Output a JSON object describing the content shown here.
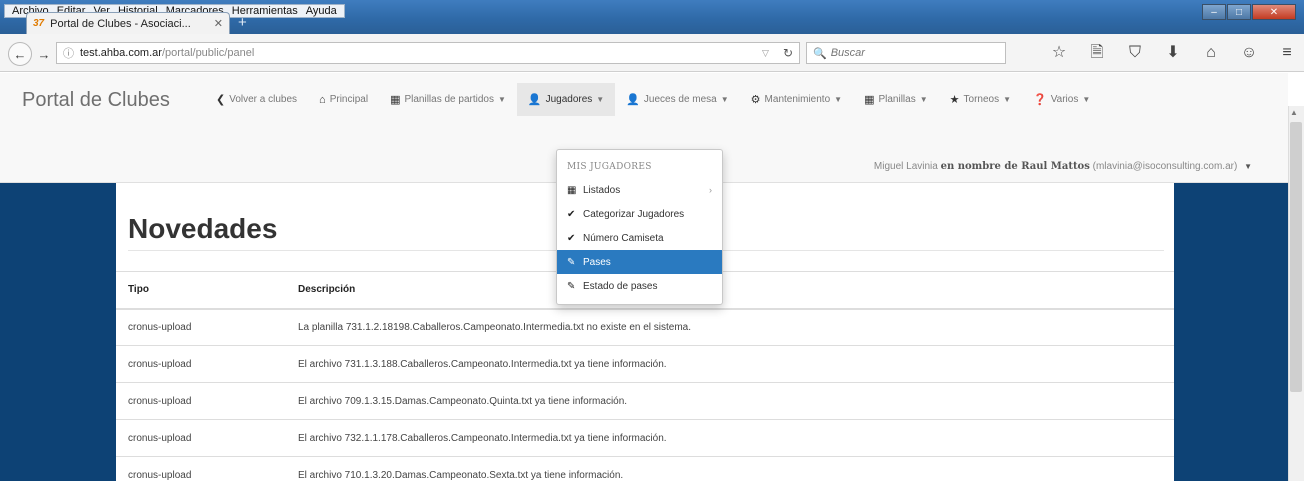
{
  "browser": {
    "menu": [
      "Archivo",
      "Editar",
      "Ver",
      "Historial",
      "Marcadores",
      "Herramientas",
      "Ayuda"
    ],
    "tab_title": "Portal de Clubes - Asociaci...",
    "tab_favicon": "37",
    "url_domain": "test.ahba.com.ar",
    "url_path": "/portal/public/panel",
    "search_placeholder": "Buscar",
    "toolbar_icons": [
      "☆",
      "🗎",
      "⛉",
      "⬇",
      "⌂",
      "☺",
      "≡"
    ]
  },
  "app": {
    "brand": "Portal de Clubes",
    "nav": [
      {
        "icon": "❮",
        "label": "Volver a clubes",
        "caret": ""
      },
      {
        "icon": "⌂",
        "label": "Principal",
        "caret": ""
      },
      {
        "icon": "▦",
        "label": "Planillas de partidos",
        "caret": "▼"
      },
      {
        "icon": "👤",
        "label": "Jugadores",
        "caret": "▼"
      },
      {
        "icon": "👤",
        "label": "Jueces de mesa",
        "caret": "▼"
      },
      {
        "icon": "⚙",
        "label": "Mantenimiento",
        "caret": "▼"
      },
      {
        "icon": "▦",
        "label": "Planillas",
        "caret": "▼"
      },
      {
        "icon": "★",
        "label": "Torneos",
        "caret": "▼"
      },
      {
        "icon": "❓",
        "label": "Varios",
        "caret": "▼"
      }
    ],
    "user_line": {
      "name": "Miguel Lavinia",
      "middle": "en nombre de Raul Mattos",
      "email": "(mlavinia@isoconsulting.com.ar)"
    }
  },
  "dropdown": {
    "header": "MIS JUGADORES",
    "items": [
      {
        "icon": "▦",
        "label": "Listados",
        "submenu": "›"
      },
      {
        "icon": "✔",
        "label": "Categorizar Jugadores",
        "submenu": ""
      },
      {
        "icon": "✔",
        "label": "Número Camiseta",
        "submenu": ""
      },
      {
        "icon": "✎",
        "label": "Pases",
        "submenu": ""
      },
      {
        "icon": "✎",
        "label": "Estado de pases",
        "submenu": ""
      }
    ]
  },
  "main": {
    "title": "Novedades",
    "columns": [
      "Tipo",
      "Descripción"
    ],
    "rows": [
      {
        "tipo": "cronus-upload",
        "desc": "La planilla 731.1.2.18198.Caballeros.Campeonato.Intermedia.txt no existe en el sistema."
      },
      {
        "tipo": "cronus-upload",
        "desc": "El archivo 731.1.3.188.Caballeros.Campeonato.Intermedia.txt ya tiene información."
      },
      {
        "tipo": "cronus-upload",
        "desc": "El archivo 709.1.3.15.Damas.Campeonato.Quinta.txt ya tiene información."
      },
      {
        "tipo": "cronus-upload",
        "desc": "El archivo 732.1.1.178.Caballeros.Campeonato.Intermedia.txt ya tiene información."
      },
      {
        "tipo": "cronus-upload",
        "desc": "El archivo 710.1.3.20.Damas.Campeonato.Sexta.txt ya tiene información."
      }
    ]
  }
}
